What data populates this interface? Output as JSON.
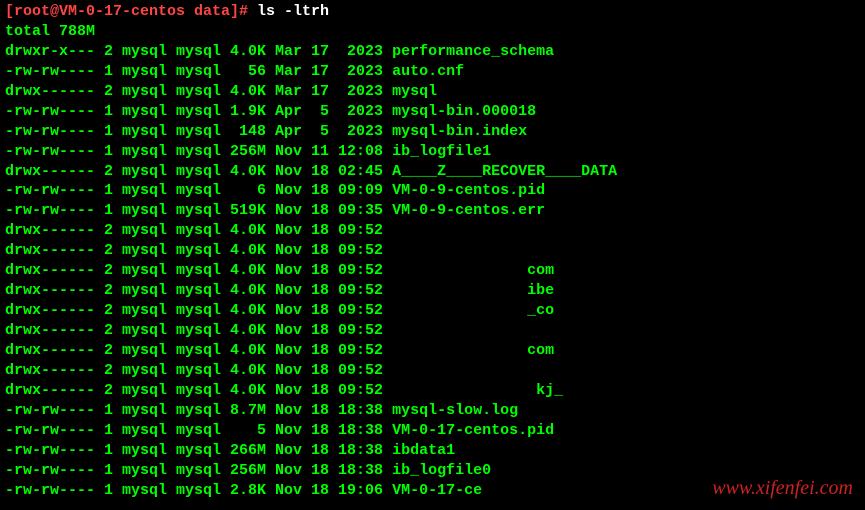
{
  "prompt": {
    "user_host": "[root@VM-0-17-centos data]# ",
    "command": "ls -ltrh"
  },
  "total_line": "total 788M",
  "rows": [
    {
      "perms": "drwxr-x--- 2 mysql mysql 4.0K Mar 17  2023 ",
      "name": "performance_schema",
      "cls": "dir"
    },
    {
      "perms": "-rw-rw---- 1 mysql mysql   56 Mar 17  2023 ",
      "name": "auto.cnf",
      "cls": "fname"
    },
    {
      "perms": "drwx------ 2 mysql mysql 4.0K Mar 17  2023 ",
      "name": "mysql",
      "cls": "dir"
    },
    {
      "perms": "-rw-rw---- 1 mysql mysql 1.9K Apr  5  2023 ",
      "name": "mysql-bin.000018",
      "cls": "fname"
    },
    {
      "perms": "-rw-rw---- 1 mysql mysql  148 Apr  5  2023 ",
      "name": "mysql-bin.index",
      "cls": "fname"
    },
    {
      "perms": "-rw-rw---- 1 mysql mysql 256M Nov 11 12:08 ",
      "name": "ib_logfile1",
      "cls": "fname"
    },
    {
      "perms": "drwx------ 2 mysql mysql 4.0K Nov 18 02:45 ",
      "name": "A____Z____RECOVER____DATA",
      "cls": "underline"
    },
    {
      "perms": "-rw-rw---- 1 mysql mysql    6 Nov 18 09:09 ",
      "name": "VM-0-9-centos.pid",
      "cls": "fname"
    },
    {
      "perms": "-rw-rw---- 1 mysql mysql 519K Nov 18 09:35 ",
      "name": "VM-0-9-centos.err",
      "cls": "fname"
    },
    {
      "perms": "drwx------ 2 mysql mysql 4.0K Nov 18 09:52 ",
      "name": "",
      "cls": "dir"
    },
    {
      "perms": "drwx------ 2 mysql mysql 4.0K Nov 18 09:52 ",
      "name": "",
      "cls": "dir"
    },
    {
      "perms": "drwx------ 2 mysql mysql 4.0K Nov 18 09:52 ",
      "name": "               com",
      "cls": "dir"
    },
    {
      "perms": "drwx------ 2 mysql mysql 4.0K Nov 18 09:52 ",
      "name": "               ibe",
      "cls": "dir"
    },
    {
      "perms": "drwx------ 2 mysql mysql 4.0K Nov 18 09:52 ",
      "name": "               _co",
      "cls": "dir"
    },
    {
      "perms": "drwx------ 2 mysql mysql 4.0K Nov 18 09:52 ",
      "name": "",
      "cls": "dir"
    },
    {
      "perms": "drwx------ 2 mysql mysql 4.0K Nov 18 09:52 ",
      "name": "               com",
      "cls": "dir"
    },
    {
      "perms": "drwx------ 2 mysql mysql 4.0K Nov 18 09:52 ",
      "name": "",
      "cls": "dir"
    },
    {
      "perms": "drwx------ 2 mysql mysql 4.0K Nov 18 09:52 ",
      "name": "                kj_",
      "cls": "dir"
    },
    {
      "perms": "-rw-rw---- 1 mysql mysql 8.7M Nov 18 18:38 ",
      "name": "mysql-slow.log",
      "cls": "fname"
    },
    {
      "perms": "-rw-rw---- 1 mysql mysql    5 Nov 18 18:38 ",
      "name": "VM-0-17-centos.pid",
      "cls": "fname"
    },
    {
      "perms": "-rw-rw---- 1 mysql mysql 266M Nov 18 18:38 ",
      "name": "ibdata1",
      "cls": "fname"
    },
    {
      "perms": "-rw-rw---- 1 mysql mysql 256M Nov 18 18:38 ",
      "name": "ib_logfile0",
      "cls": "fname"
    },
    {
      "perms": "-rw-rw---- 1 mysql mysql 2.8K Nov 18 19:06 ",
      "name": "VM-0-17-ce",
      "cls": "fname"
    }
  ],
  "watermark": "www.xifenfei.com"
}
